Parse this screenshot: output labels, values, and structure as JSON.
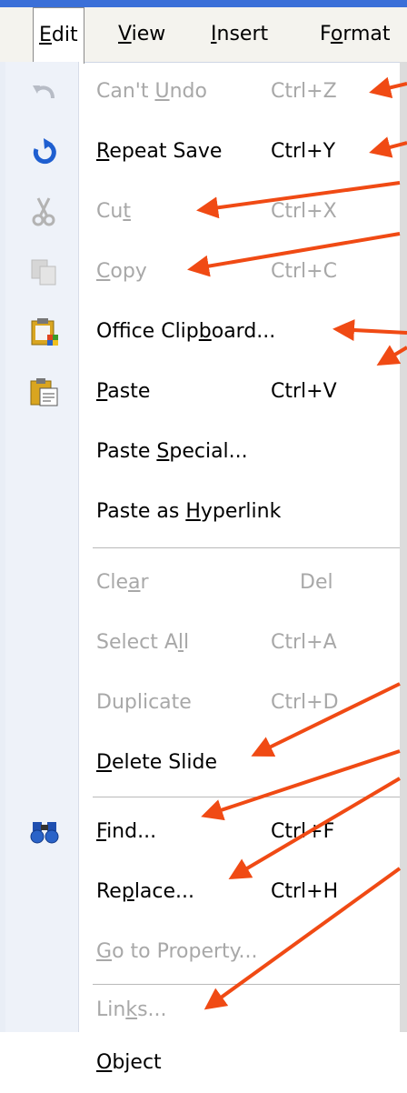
{
  "menubar": {
    "items": [
      {
        "name": "edit",
        "label": "Edit",
        "underline": 0
      },
      {
        "name": "view",
        "label": "View",
        "underline": 0
      },
      {
        "name": "insert",
        "label": "Insert",
        "underline": 0
      },
      {
        "name": "format",
        "label": "Format",
        "underline": 1
      }
    ]
  },
  "edit_menu": {
    "items": [
      {
        "label": "Can't Undo",
        "shortcut": "Ctrl+Z",
        "underline": 6,
        "disabled": true,
        "icon": "undo-icon"
      },
      {
        "label": "Repeat Save",
        "shortcut": "Ctrl+Y",
        "underline": 0,
        "disabled": false,
        "icon": "repeat-icon"
      },
      {
        "label": "Cut",
        "shortcut": "Ctrl+X",
        "underline": 2,
        "disabled": true,
        "icon": "scissors-icon"
      },
      {
        "label": "Copy",
        "shortcut": "Ctrl+C",
        "underline": 0,
        "disabled": true,
        "icon": "copy-icon"
      },
      {
        "label": "Office Clipboard...",
        "shortcut": "",
        "underline": 11,
        "disabled": false,
        "icon": "office-clipboard-icon"
      },
      {
        "label": "Paste",
        "shortcut": "Ctrl+V",
        "underline": 0,
        "disabled": false,
        "icon": "paste-icon"
      },
      {
        "label": "Paste Special...",
        "shortcut": "",
        "underline": 6,
        "disabled": false,
        "icon": ""
      },
      {
        "label": "Paste as Hyperlink",
        "shortcut": "",
        "underline": 9,
        "disabled": false,
        "icon": ""
      },
      {
        "label": "Clear",
        "shortcut": "Del",
        "underline": 3,
        "disabled": true,
        "icon": ""
      },
      {
        "label": "Select All",
        "shortcut": "Ctrl+A",
        "underline": 8,
        "disabled": true,
        "icon": ""
      },
      {
        "label": "Duplicate",
        "shortcut": "Ctrl+D",
        "underline": -1,
        "disabled": true,
        "icon": ""
      },
      {
        "label": "Delete Slide",
        "shortcut": "",
        "underline": 0,
        "disabled": false,
        "icon": ""
      },
      {
        "label": "Find...",
        "shortcut": "Ctrl+F",
        "underline": 0,
        "disabled": false,
        "icon": "binoculars-icon"
      },
      {
        "label": "Replace...",
        "shortcut": "Ctrl+H",
        "underline": 2,
        "disabled": false,
        "icon": ""
      },
      {
        "label": "Go to Property...",
        "shortcut": "",
        "underline": 0,
        "disabled": true,
        "icon": ""
      },
      {
        "label": "Links...",
        "shortcut": "",
        "underline": 3,
        "disabled": true,
        "icon": ""
      },
      {
        "label": "Object",
        "shortcut": "",
        "underline": 0,
        "disabled": false,
        "icon": ""
      }
    ]
  },
  "colors": {
    "arrow": "#f04a14",
    "menubar": "#f4f3ee",
    "iconcol": "#eef2f9",
    "disabled_text": "#a8a8a8"
  }
}
